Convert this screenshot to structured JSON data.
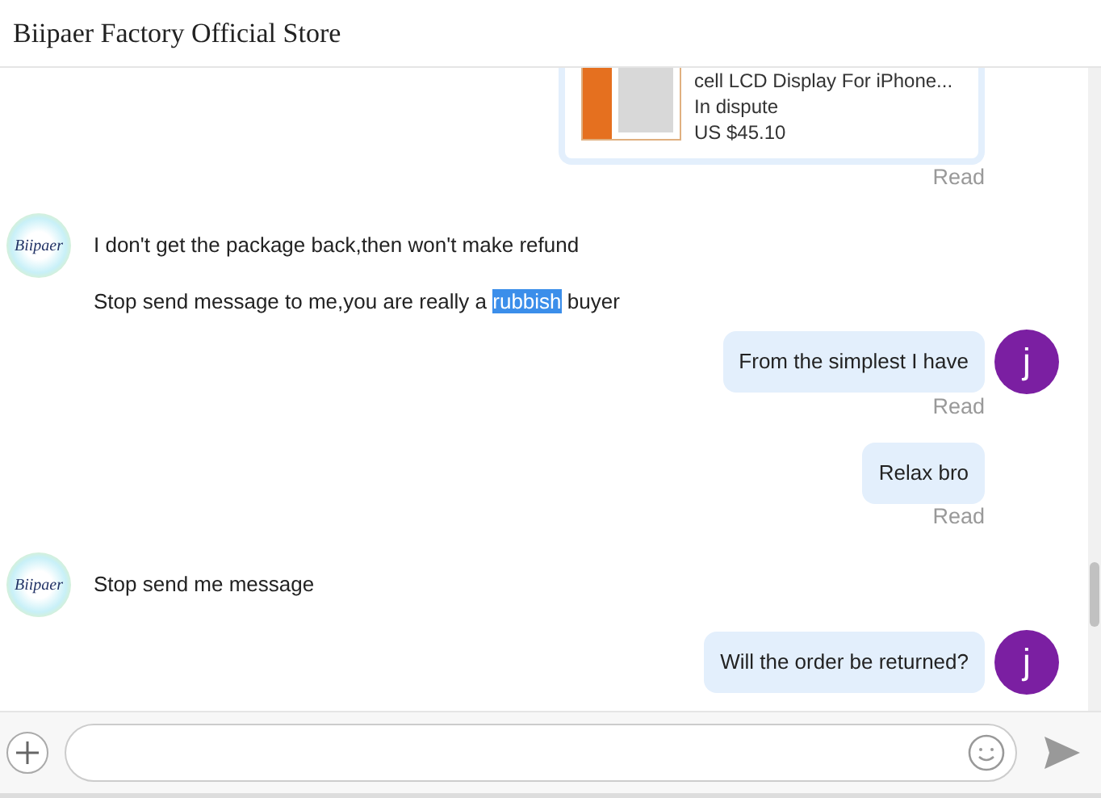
{
  "header": {
    "title": "Biipaer Factory Official Store"
  },
  "messages": [
    {
      "kind": "product",
      "title": "cell LCD Display For iPhone...",
      "status": "In dispute",
      "price": "US $45.10",
      "receipt": "Read"
    },
    {
      "kind": "incoming",
      "avatar": "Biipaer",
      "segments": [
        {
          "text": "I don't get the package back,then won't make refund",
          "selected": false
        }
      ]
    },
    {
      "kind": "incoming",
      "segments": [
        {
          "text": "Stop send message to me,you are really a ",
          "selected": false
        },
        {
          "text": "rubbish",
          "selected": true
        },
        {
          "text": " buyer",
          "selected": false
        }
      ]
    },
    {
      "kind": "outgoing",
      "avatar": "j",
      "segments": [
        {
          "text": "From the simplest I have",
          "selected": false
        }
      ],
      "receipt": "Read"
    },
    {
      "kind": "outgoing",
      "segments": [
        {
          "text": "Relax bro",
          "selected": false
        }
      ],
      "receipt": "Read"
    },
    {
      "kind": "incoming",
      "avatar": "Biipaer",
      "segments": [
        {
          "text": "Stop send me message",
          "selected": false
        }
      ]
    },
    {
      "kind": "outgoing",
      "avatar": "j",
      "segments": [
        {
          "text": "Will the order be returned?",
          "selected": false
        }
      ]
    }
  ]
}
